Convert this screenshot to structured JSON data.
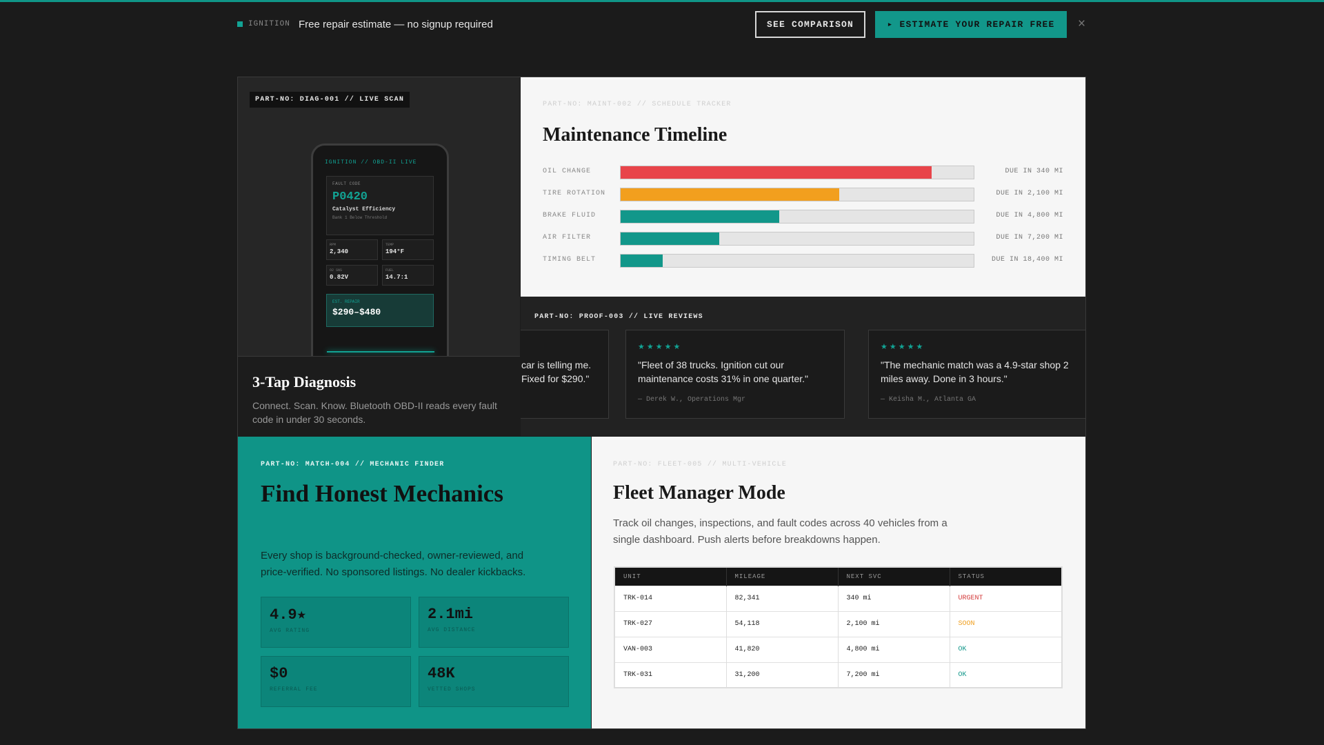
{
  "topbar": {
    "brand": "IGNITION",
    "promo": "Free repair estimate — no signup required",
    "compare_label": "SEE COMPARISON",
    "estimate_label": "▸ ESTIMATE YOUR REPAIR FREE",
    "close_glyph": "×"
  },
  "diag": {
    "tag": "PART-NO: DIAG-001 // LIVE SCAN",
    "phone_header": "IGNITION // OBD-II LIVE",
    "fault_label": "FAULT CODE",
    "fault_code": "P0420",
    "fault_desc": "Catalyst Efficiency",
    "fault_sub": "Bank 1 Below Threshold",
    "stats": [
      {
        "key": "RPM",
        "value": "2,340"
      },
      {
        "key": "TEMP",
        "value": "194°F"
      },
      {
        "key": "O2 SNS",
        "value": "0.82V"
      },
      {
        "key": "FUEL",
        "value": "14.7:1"
      }
    ],
    "repair_label": "EST. REPAIR",
    "repair_value": "$290–$480",
    "title": "3-Tap Diagnosis",
    "desc": "Connect. Scan. Know. Bluetooth OBD-II reads every fault code in under 30 seconds."
  },
  "maint": {
    "tag": "PART-NO: MAINT-002 // SCHEDULE TRACKER",
    "title": "Maintenance Timeline",
    "rows": [
      {
        "label": "OIL CHANGE",
        "progress": 0.88,
        "color": "#e8444a",
        "due": "DUE IN 340 MI"
      },
      {
        "label": "TIRE ROTATION",
        "progress": 0.62,
        "color": "#f29f1e",
        "due": "DUE IN 2,100 MI"
      },
      {
        "label": "BRAKE FLUID",
        "progress": 0.45,
        "color": "#12978a",
        "due": "DUE IN 4,800 MI"
      },
      {
        "label": "AIR FILTER",
        "progress": 0.28,
        "color": "#12978a",
        "due": "DUE IN 7,200 MI"
      },
      {
        "label": "TIMING BELT",
        "progress": 0.12,
        "color": "#12978a",
        "due": "DUE IN 18,400 MI"
      }
    ]
  },
  "reviews": {
    "tag": "PART-NO: PROOF-003 // LIVE REVIEWS",
    "items": [
      {
        "stars": "★★★★★",
        "quote": "car is telling me. Fixed for $290.\"",
        "who": ""
      },
      {
        "stars": "★★★★★",
        "quote": "\"Fleet of 38 trucks. Ignition cut our maintenance costs 31% in one quarter.\"",
        "who": "— Derek W., Operations Mgr"
      },
      {
        "stars": "★★★★★",
        "quote": "\"The mechanic match was a 4.9-star shop 2 miles away. Done in 3 hours.\"",
        "who": "— Keisha M., Atlanta GA"
      }
    ]
  },
  "match": {
    "tag": "PART-NO: MATCH-004 // MECHANIC FINDER",
    "title": "Find Honest Mechanics",
    "desc": "Every shop is background-checked, owner-reviewed, and price-verified. No sponsored listings. No dealer kickbacks.",
    "stats": [
      {
        "value": "4.9★",
        "label": "AVG RATING"
      },
      {
        "value": "2.1mi",
        "label": "AVG DISTANCE"
      },
      {
        "value": "$0",
        "label": "REFERRAL FEE"
      },
      {
        "value": "48K",
        "label": "VETTED SHOPS"
      }
    ]
  },
  "fleet": {
    "tag": "PART-NO: FLEET-005 // MULTI-VEHICLE",
    "title": "Fleet Manager Mode",
    "desc": "Track oil changes, inspections, and fault codes across 40 vehicles from a single dashboard. Push alerts before breakdowns happen.",
    "columns": [
      "UNIT",
      "MILEAGE",
      "NEXT SVC",
      "STATUS"
    ],
    "rows": [
      {
        "unit": "TRK-014",
        "mileage": "82,341",
        "next": "340 mi",
        "status": "URGENT"
      },
      {
        "unit": "TRK-027",
        "mileage": "54,118",
        "next": "2,100 mi",
        "status": "SOON"
      },
      {
        "unit": "VAN-003",
        "mileage": "41,820",
        "next": "4,800 mi",
        "status": "OK"
      },
      {
        "unit": "TRK-031",
        "mileage": "31,200",
        "next": "7,200 mi",
        "status": "OK"
      }
    ]
  }
}
